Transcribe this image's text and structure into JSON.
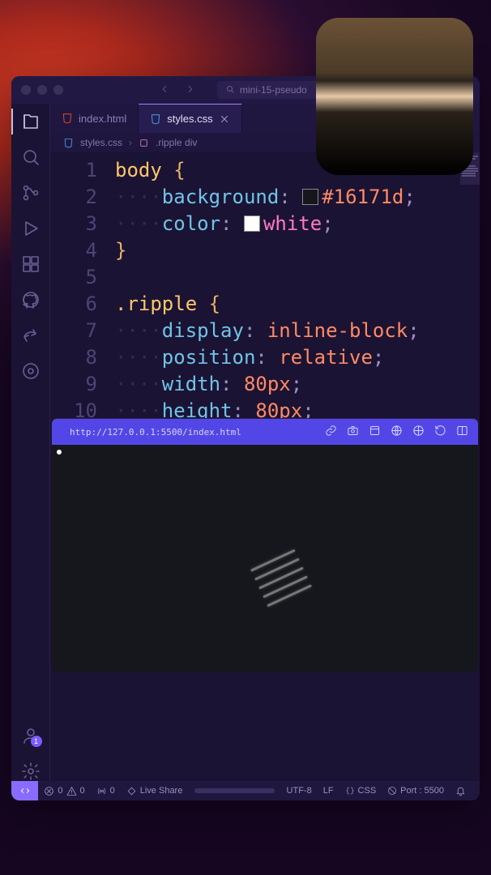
{
  "window": {
    "search_text": "mini-15-pseudo"
  },
  "tabs": [
    {
      "label": "index.html",
      "icon": "html",
      "active": false
    },
    {
      "label": "styles.css",
      "icon": "css",
      "active": true
    }
  ],
  "breadcrumb": {
    "file": "styles.css",
    "symbol": ".ripple div"
  },
  "code": {
    "lines": [
      1,
      2,
      3,
      4,
      5,
      6,
      7,
      8,
      9,
      10
    ],
    "body_selector": "body",
    "bg_prop": "background",
    "bg_value": "#16171d",
    "color_prop": "color",
    "color_value": "white",
    "ripple_selector": ".ripple",
    "display_prop": "display",
    "display_value": "inline-block",
    "position_prop": "position",
    "position_value": "relative",
    "width_prop": "width",
    "width_value": "80px",
    "height_prop": "height",
    "height_value": "80px"
  },
  "preview": {
    "url": "http://127.0.0.1:5500/index.html"
  },
  "statusbar": {
    "errors": "0",
    "warnings": "0",
    "radio": "0",
    "live_share": "Live Share",
    "encoding": "UTF-8",
    "eol": "LF",
    "language": "CSS",
    "port": "Port : 5500"
  },
  "accounts_badge": "1"
}
